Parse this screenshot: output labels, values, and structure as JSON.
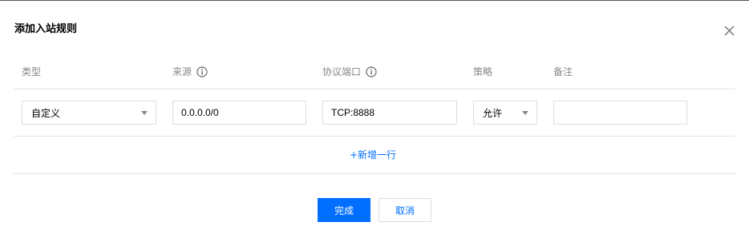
{
  "dialog": {
    "title": "添加入站规则",
    "close_icon": "close-icon"
  },
  "table": {
    "headers": {
      "type": "类型",
      "source": "来源",
      "port": "协议端口",
      "policy": "策略",
      "note": "备注"
    },
    "info_icon": "info-circle-icon",
    "row": {
      "type_value": "自定义",
      "source_value": "0.0.0.0/0",
      "port_value": "TCP:8888",
      "policy_value": "允许",
      "note_value": ""
    },
    "add_row_label": "+新增一行"
  },
  "footer": {
    "confirm_label": "完成",
    "cancel_label": "取消"
  },
  "colors": {
    "accent": "#006eff",
    "header_text": "#888888",
    "border": "#dddddd",
    "divider": "#e5e5e5"
  }
}
